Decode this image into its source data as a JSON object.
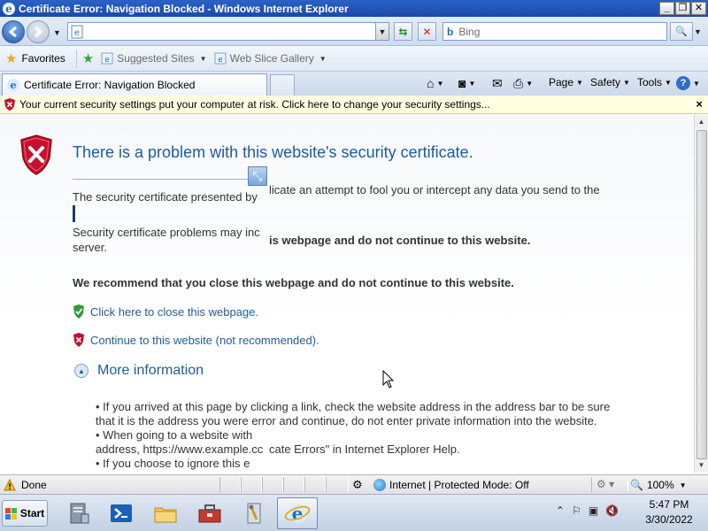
{
  "window": {
    "title": "Certificate Error: Navigation Blocked - Windows Internet Explorer",
    "buttons": {
      "minimize": "_",
      "maximize": "❐",
      "close": "✕"
    }
  },
  "addressbar": {
    "url": "",
    "search_placeholder": "Bing"
  },
  "favorites_bar": {
    "favorites_label": "Favorites",
    "items": [
      {
        "label": "Suggested Sites"
      },
      {
        "label": "Web Slice Gallery"
      }
    ]
  },
  "tab": {
    "label": "Certificate Error: Navigation Blocked"
  },
  "command_bar": {
    "page": "Page",
    "safety": "Safety",
    "tools": "Tools"
  },
  "infobar": {
    "message": "Your current security settings put your computer at risk. Click here to change your security settings...",
    "close": "×"
  },
  "content": {
    "heading": "There is a problem with this website's security certificate.",
    "para1_left": "The security certificate presented by",
    "para1_right": "licate an attempt to fool you or intercept any data you send to the",
    "para2_line1": "Security certificate problems may inc",
    "para2_line2": "server.",
    "bold_fragment": "is webpage and do not continue to this website.",
    "recommend": "We recommend that you close this webpage and do not continue to this website.",
    "close_link": "Click here to close this webpage.",
    "continue_link": "Continue to this website (not recommended).",
    "more_info": "More information",
    "bullets": [
      "• If you arrived at this page by clicking a link, check the website address in the address bar to be sure",
      "that it is the address you were error and continue, do not enter private information into the website.",
      "• When going to a website with",
      "address, https://www.example.cc",
      "• If you choose to ignore this e"
    ],
    "bullet_right": "cate Errors\" in Internet Explorer Help."
  },
  "statusbar": {
    "done": "Done",
    "zone": "Internet | Protected Mode: Off",
    "zoom": "100%"
  },
  "taskbar": {
    "start": "Start",
    "time": "5:47 PM",
    "date": "3/30/2022"
  },
  "colors": {
    "link": "#1f5c96",
    "heading": "#1f5c96",
    "infobar": "#ffffe1",
    "title_bar": "#2b62c7"
  }
}
